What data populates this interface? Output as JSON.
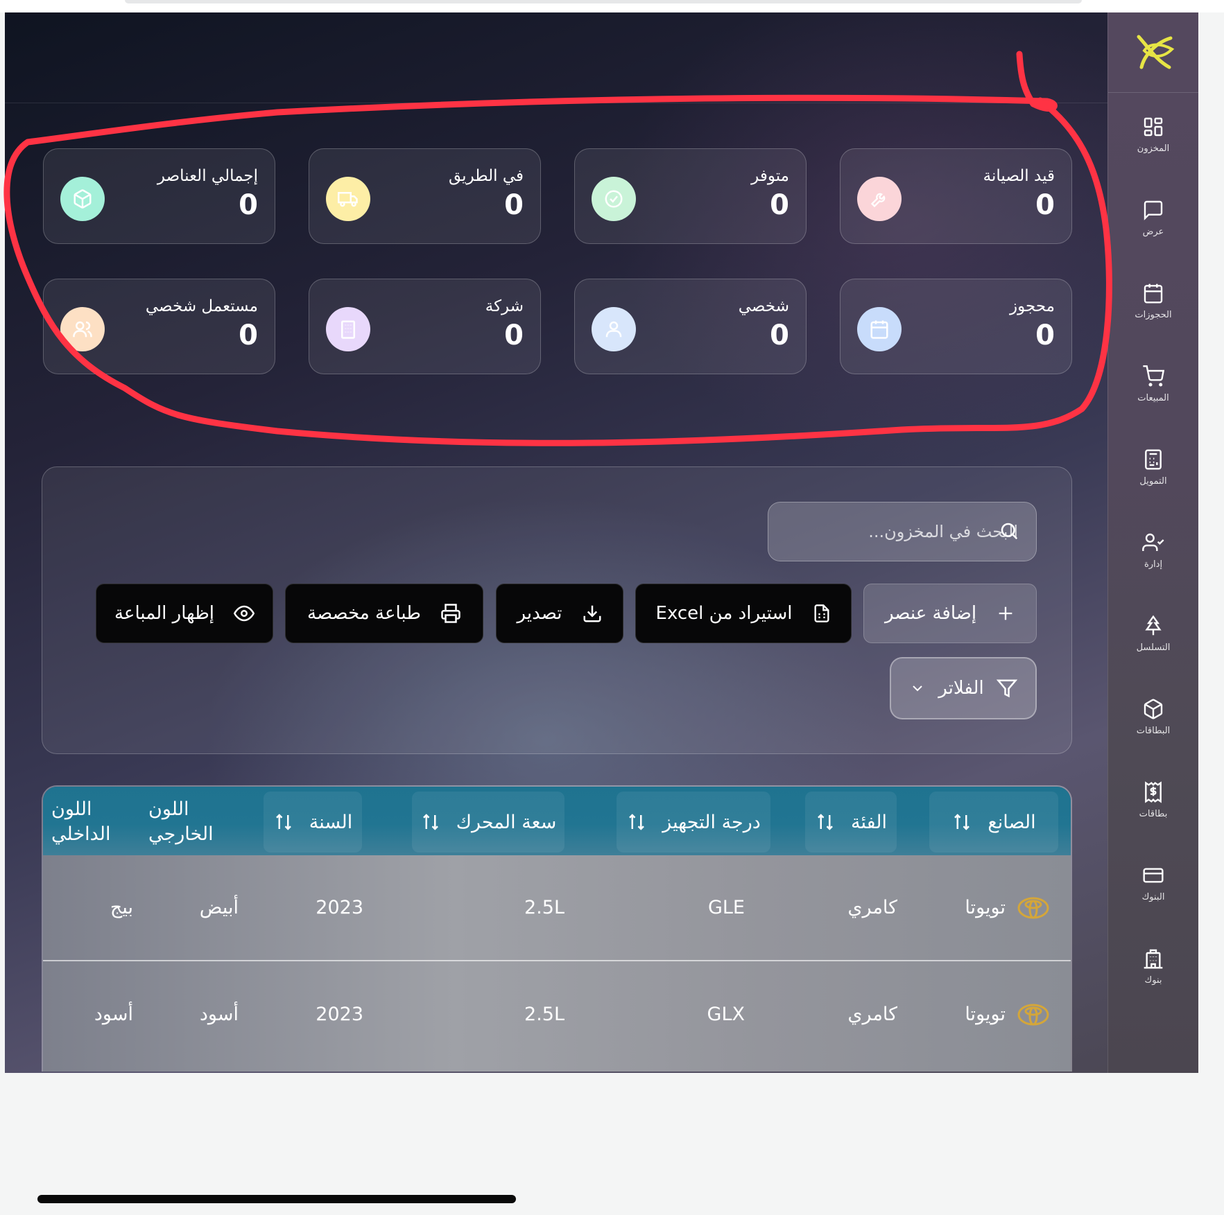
{
  "sidebar": {
    "logo": "brand-logo",
    "items": [
      {
        "label": "المخزون",
        "icon": "grid-icon"
      },
      {
        "label": "عرض",
        "icon": "message-square-icon"
      },
      {
        "label": "الحجوزات",
        "icon": "calendar-icon"
      },
      {
        "label": "المبيعات",
        "icon": "cart-icon"
      },
      {
        "label": "التمويل",
        "icon": "calculator-icon"
      },
      {
        "label": "إدارة",
        "icon": "user-check-icon"
      },
      {
        "label": "التسلسل",
        "icon": "tree-icon"
      },
      {
        "label": "البطاقات",
        "icon": "box-icon"
      },
      {
        "label": "بطاقات",
        "icon": "dollar-receipt-icon"
      },
      {
        "label": "البنوك",
        "icon": "credit-card-icon"
      },
      {
        "label": "بنوك",
        "icon": "building-icon"
      }
    ]
  },
  "stats": [
    {
      "title": "قيد الصيانة",
      "value": "0",
      "icon": "wrench-icon",
      "color": "#fbd5d9"
    },
    {
      "title": "متوفر",
      "value": "0",
      "icon": "check-circle-icon",
      "color": "#c9f3d8"
    },
    {
      "title": "في الطريق",
      "value": "0",
      "icon": "truck-icon",
      "color": "#fdeea6"
    },
    {
      "title": "إجمالي العناصر",
      "value": "0",
      "icon": "package-icon",
      "color": "#a4f0d9"
    },
    {
      "title": "محجوز",
      "value": "0",
      "icon": "calendar-icon",
      "color": "#c8dcfb"
    },
    {
      "title": "شخصي",
      "value": "0",
      "icon": "user-icon",
      "color": "#d8e6fb"
    },
    {
      "title": "شركة",
      "value": "0",
      "icon": "building-icon",
      "color": "#e8d8fb"
    },
    {
      "title": "مستعمل شخصي",
      "value": "0",
      "icon": "users-icon",
      "color": "#fde0c4"
    }
  ],
  "toolbar": {
    "search_placeholder": "البحث في المخزون...",
    "add_item": "إضافة عنصر",
    "import_excel": "استيراد من Excel",
    "export": "تصدير",
    "custom_print": "طباعة مخصصة",
    "show_sold": "إظهار المباعة",
    "filters": "الفلاتر"
  },
  "table": {
    "headers": {
      "manufacturer": "الصانع",
      "category": "الفئة",
      "trim": "درجة التجهيز",
      "engine": "سعة المحرك",
      "year": "السنة",
      "exterior_1": "اللون",
      "exterior_2": "الخارجي",
      "interior_1": "اللون",
      "interior_2": "الداخلي"
    },
    "rows": [
      {
        "manufacturer": "تويوتا",
        "category": "كامري",
        "trim": "GLE",
        "engine": "2.5L",
        "year": "2023",
        "exterior": "أبيض",
        "interior": "بيج"
      },
      {
        "manufacturer": "تويوتا",
        "category": "كامري",
        "trim": "GLX",
        "engine": "2.5L",
        "year": "2023",
        "exterior": "أسود",
        "interior": "أسود"
      }
    ]
  },
  "colors": {
    "accent": "#1f7390",
    "annotation": "#ff3344",
    "brand_logo": "#e7e545",
    "toyota_logo": "#d4a63a"
  }
}
